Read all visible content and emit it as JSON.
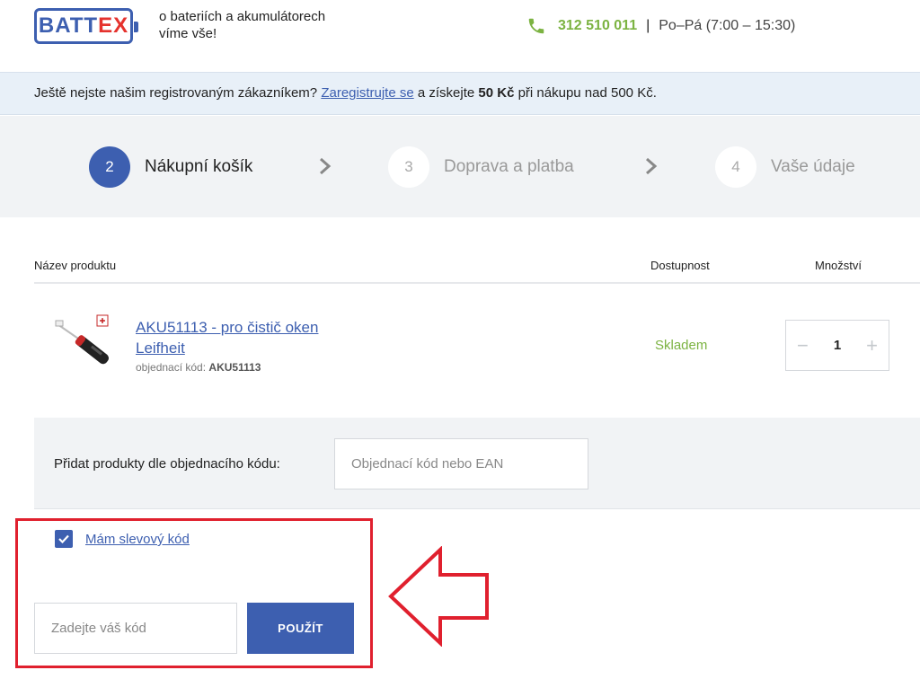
{
  "header": {
    "logo_left": "BATT",
    "logo_right": "EX",
    "tagline": "o bateriích a akumulátorech víme vše!",
    "phone": "312 510 011",
    "separator": "|",
    "hours": "Po–Pá (7:00 – 15:30)"
  },
  "banner": {
    "text_before": "Ještě nejste našim registrovaným zákazníkem? ",
    "link": "Zaregistrujte se",
    "text_middle": " a získejte ",
    "bonus": "50 Kč",
    "text_after": " při nákupu nad 500 Kč."
  },
  "steps": [
    {
      "num": "2",
      "label": "Nákupní košík",
      "active": true
    },
    {
      "num": "3",
      "label": "Doprava a platba",
      "active": false
    },
    {
      "num": "4",
      "label": "Vaše údaje",
      "active": false
    }
  ],
  "table": {
    "col_name": "Název produktu",
    "col_availability": "Dostupnost",
    "col_quantity": "Množství"
  },
  "product": {
    "name": "AKU51113 - pro čistič oken Leifheit",
    "code_label": "objednací kód: ",
    "code": "AKU51113",
    "availability": "Skladem",
    "quantity": "1",
    "minus": "−",
    "plus": "+"
  },
  "add_by_code": {
    "label": "Přidat produkty dle objednacího kódu:",
    "placeholder": "Objednací kód nebo EAN"
  },
  "discount": {
    "checkbox_label": "Mám slevový kód",
    "placeholder": "Zadejte váš kód",
    "apply_label": "POUŽÍT"
  },
  "colors": {
    "brand_blue": "#3d5fb0",
    "brand_red": "#e5322d",
    "green": "#7cb342",
    "highlight_red": "#e0202e"
  }
}
